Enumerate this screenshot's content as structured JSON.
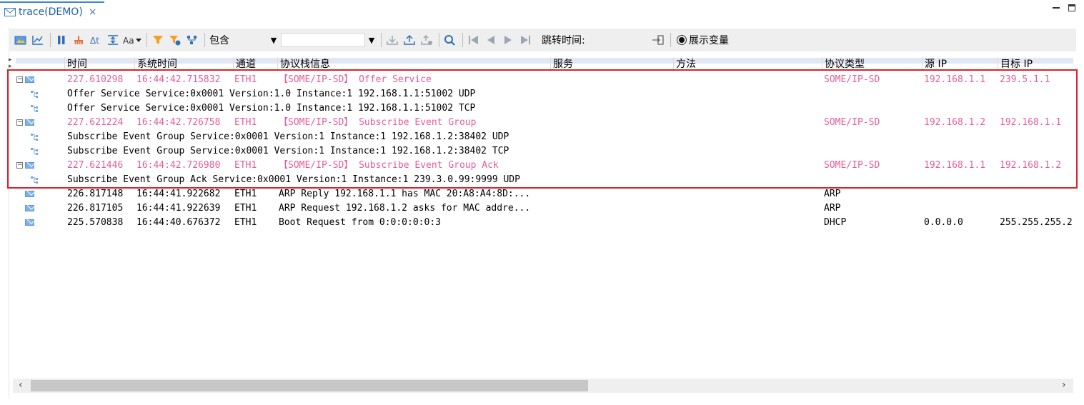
{
  "tab": {
    "title": "trace(DEMO)",
    "close": "×"
  },
  "toolbar": {
    "filter_mode": "包含",
    "filter_text": "",
    "jump_label": "跳转时间:",
    "show_vars_label": "展示变量"
  },
  "columns": [
    "时间",
    "系统时间",
    "通道",
    "协议栈信息",
    "服务",
    "方法",
    "协议类型",
    "源 IP",
    "目标 IP"
  ],
  "highlight_color": "#e0202a",
  "sd_color": "#e65c9b",
  "rows": [
    {
      "kind": "sd",
      "expand": "−",
      "time": "227.610298",
      "systime": "16:44:42.715832",
      "channel": "ETH1",
      "info": "【SOME/IP-SD】 Offer Service",
      "proto": "SOME/IP-SD",
      "src": "192.168.1.1",
      "dst": "239.5.1.1"
    },
    {
      "kind": "child",
      "info": "Offer Service   Service:0x0001   Version:1.0   Instance:1   192.168.1.1:51002   UDP"
    },
    {
      "kind": "child",
      "info": "Offer Service   Service:0x0001   Version:1.0   Instance:1   192.168.1.1:51002   TCP"
    },
    {
      "kind": "sd",
      "expand": "−",
      "time": "227.621224",
      "systime": "16:44:42.726758",
      "channel": "ETH1",
      "info": "【SOME/IP-SD】 Subscribe Event Group",
      "proto": "SOME/IP-SD",
      "src": "192.168.1.2",
      "dst": "192.168.1.1"
    },
    {
      "kind": "child",
      "info": "Subscribe Event Group   Service:0x0001   Version:1   Instance:1   192.168.1.2:38402   UDP"
    },
    {
      "kind": "child",
      "info": "Subscribe Event Group   Service:0x0001   Version:1   Instance:1   192.168.1.2:38402   TCP"
    },
    {
      "kind": "sd",
      "expand": "−",
      "time": "227.621446",
      "systime": "16:44:42.726980",
      "channel": "ETH1",
      "info": "【SOME/IP-SD】 Subscribe Event Group Ack",
      "proto": "SOME/IP-SD",
      "src": "192.168.1.1",
      "dst": "192.168.1.2"
    },
    {
      "kind": "child",
      "info": "Subscribe Event Group Ack   Service:0x0001   Version:1   Instance:1   239.3.0.99:9999   UDP"
    },
    {
      "kind": "plain",
      "time": "226.817148",
      "systime": "16:44:41.922682",
      "channel": "ETH1",
      "info": "ARP Reply   192.168.1.1 has MAC 20:A8:A4:8D:...",
      "proto": "ARP",
      "src": "",
      "dst": ""
    },
    {
      "kind": "plain",
      "time": "226.817105",
      "systime": "16:44:41.922639",
      "channel": "ETH1",
      "info": "ARP Request   192.168.1.2 asks for MAC addre...",
      "proto": "ARP",
      "src": "",
      "dst": ""
    },
    {
      "kind": "plain",
      "time": "225.570838",
      "systime": "16:44:40.676372",
      "channel": "ETH1",
      "info": "Boot Request from   0:0:0:0:0:3",
      "proto": "DHCP",
      "src": "0.0.0.0",
      "dst": "255.255.255.2"
    }
  ]
}
